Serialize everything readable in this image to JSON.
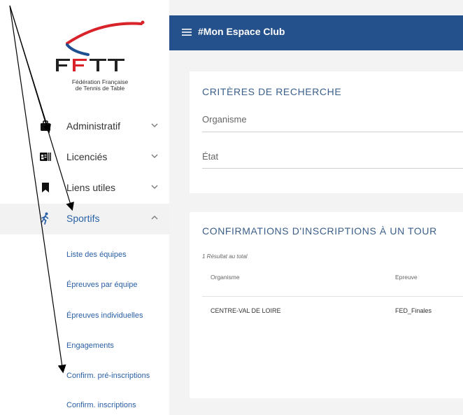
{
  "logo": {
    "letters": "FFTT",
    "subtitle_line1": "Fédération Française",
    "subtitle_line2": "de Tennis de Table"
  },
  "sidebar": {
    "items": [
      {
        "label": "Administratif",
        "icon": "briefcase-icon",
        "expanded": false
      },
      {
        "label": "Licenciés",
        "icon": "id-card-icon",
        "expanded": false
      },
      {
        "label": "Liens utiles",
        "icon": "bookmark-icon",
        "expanded": false
      },
      {
        "label": "Sportifs",
        "icon": "runner-icon",
        "expanded": true
      }
    ],
    "subitems": [
      {
        "label": "Liste des équipes"
      },
      {
        "label": "Épreuves par équipe"
      },
      {
        "label": "Épreuves individuelles"
      },
      {
        "label": "Engagements"
      },
      {
        "label": "Confirm. pré-inscriptions"
      },
      {
        "label": "Confirm. inscriptions"
      }
    ]
  },
  "header": {
    "title": "#Mon Espace Club"
  },
  "criteria": {
    "title": "CRITÈRES DE RECHERCHE",
    "organisme_label": "Organisme",
    "etat_label": "État"
  },
  "confirmations": {
    "title": "CONFIRMATIONS D'INSCRIPTIONS À UN TOUR",
    "result_count": "1 Résultat au total",
    "columns": [
      "Organisme",
      "Epreuve"
    ],
    "rows": [
      [
        "CENTRE-VAL DE LOIRE",
        "FED_Finales"
      ]
    ]
  },
  "colors": {
    "header_bg": "#24508c",
    "link": "#2a5fa5",
    "card_title": "#3b5f8a",
    "logo_red": "#d8232a",
    "logo_blue": "#1d4f91"
  }
}
